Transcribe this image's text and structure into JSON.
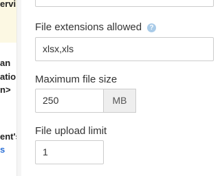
{
  "sidebar": {
    "fragments": [
      "ervi",
      "an",
      "ation",
      "n>",
      "ent's",
      "s"
    ]
  },
  "form": {
    "extensions": {
      "label": "File extensions allowed",
      "value": "xlsx,xls"
    },
    "max_size": {
      "label": "Maximum file size",
      "value": "250",
      "unit": "MB"
    },
    "upload_limit": {
      "label": "File upload limit",
      "value": "1"
    }
  },
  "icons": {
    "help": "question-circle-icon"
  },
  "colors": {
    "sidebar_highlight": "#fcf8e3",
    "help_icon": "#a9cbe8",
    "addon_bg": "#eeeeee"
  }
}
